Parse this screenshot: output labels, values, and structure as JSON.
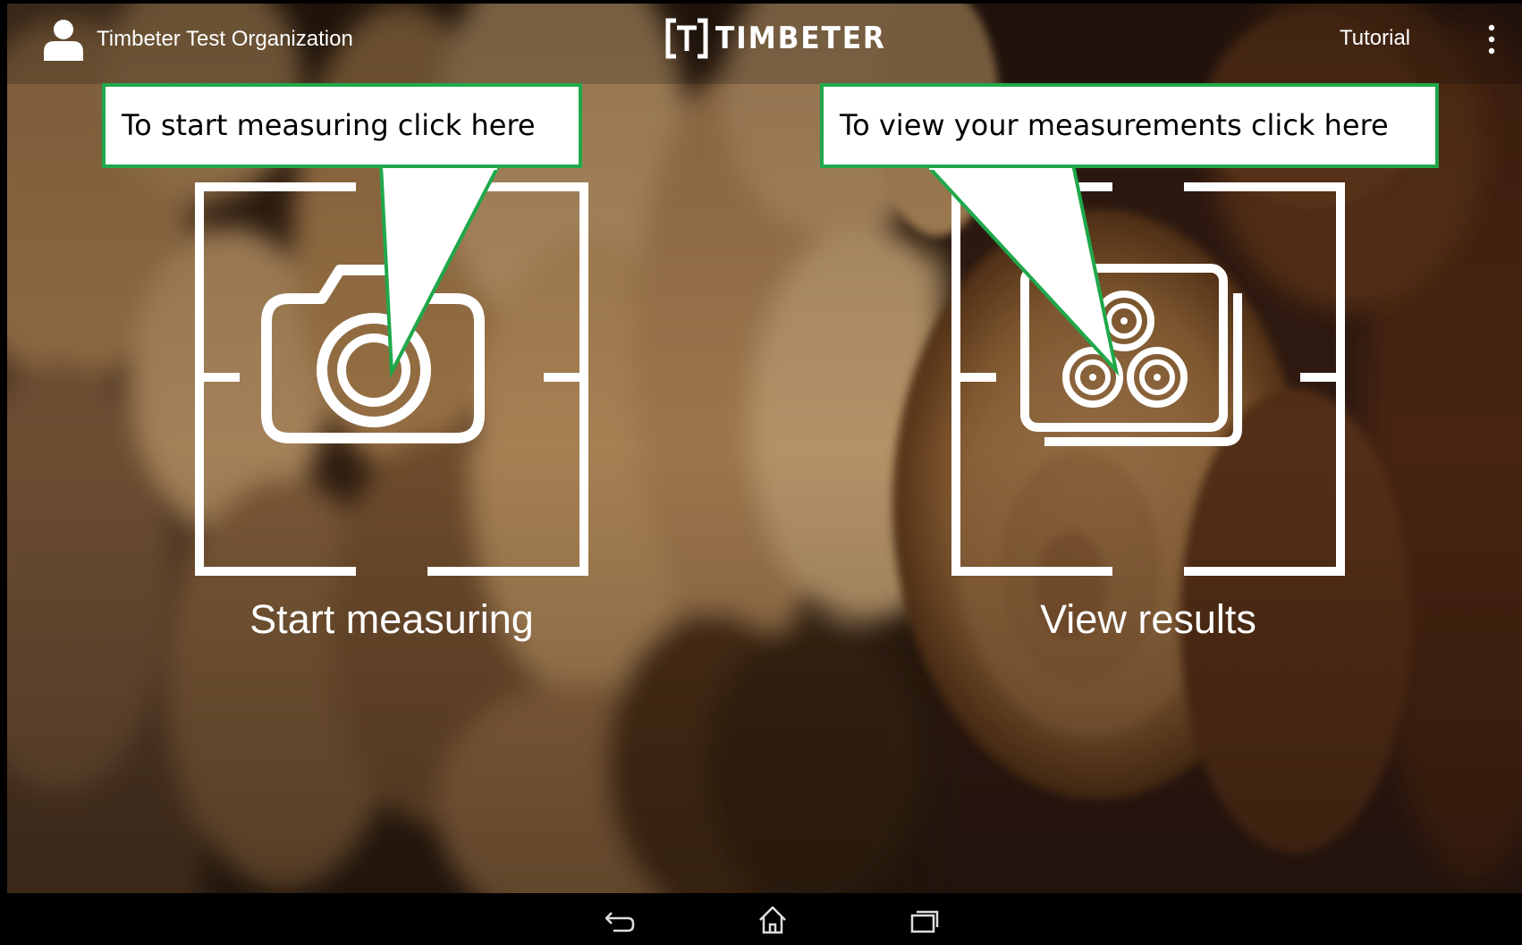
{
  "app": {
    "organization_name": "Timbeter Test Organization",
    "logo_text": "TIMBETER",
    "tutorial_label": "Tutorial"
  },
  "tiles": {
    "start": {
      "label": "Start measuring",
      "icon": "camera-icon"
    },
    "results": {
      "label": "View results",
      "icon": "log-stack-photo-icon"
    }
  },
  "callouts": {
    "start": "To start measuring  click here",
    "results": "To view your measurements click here",
    "border_color": "#1fa84a"
  },
  "nav": {
    "icons": [
      "back-icon",
      "home-icon",
      "recent-apps-icon"
    ]
  }
}
